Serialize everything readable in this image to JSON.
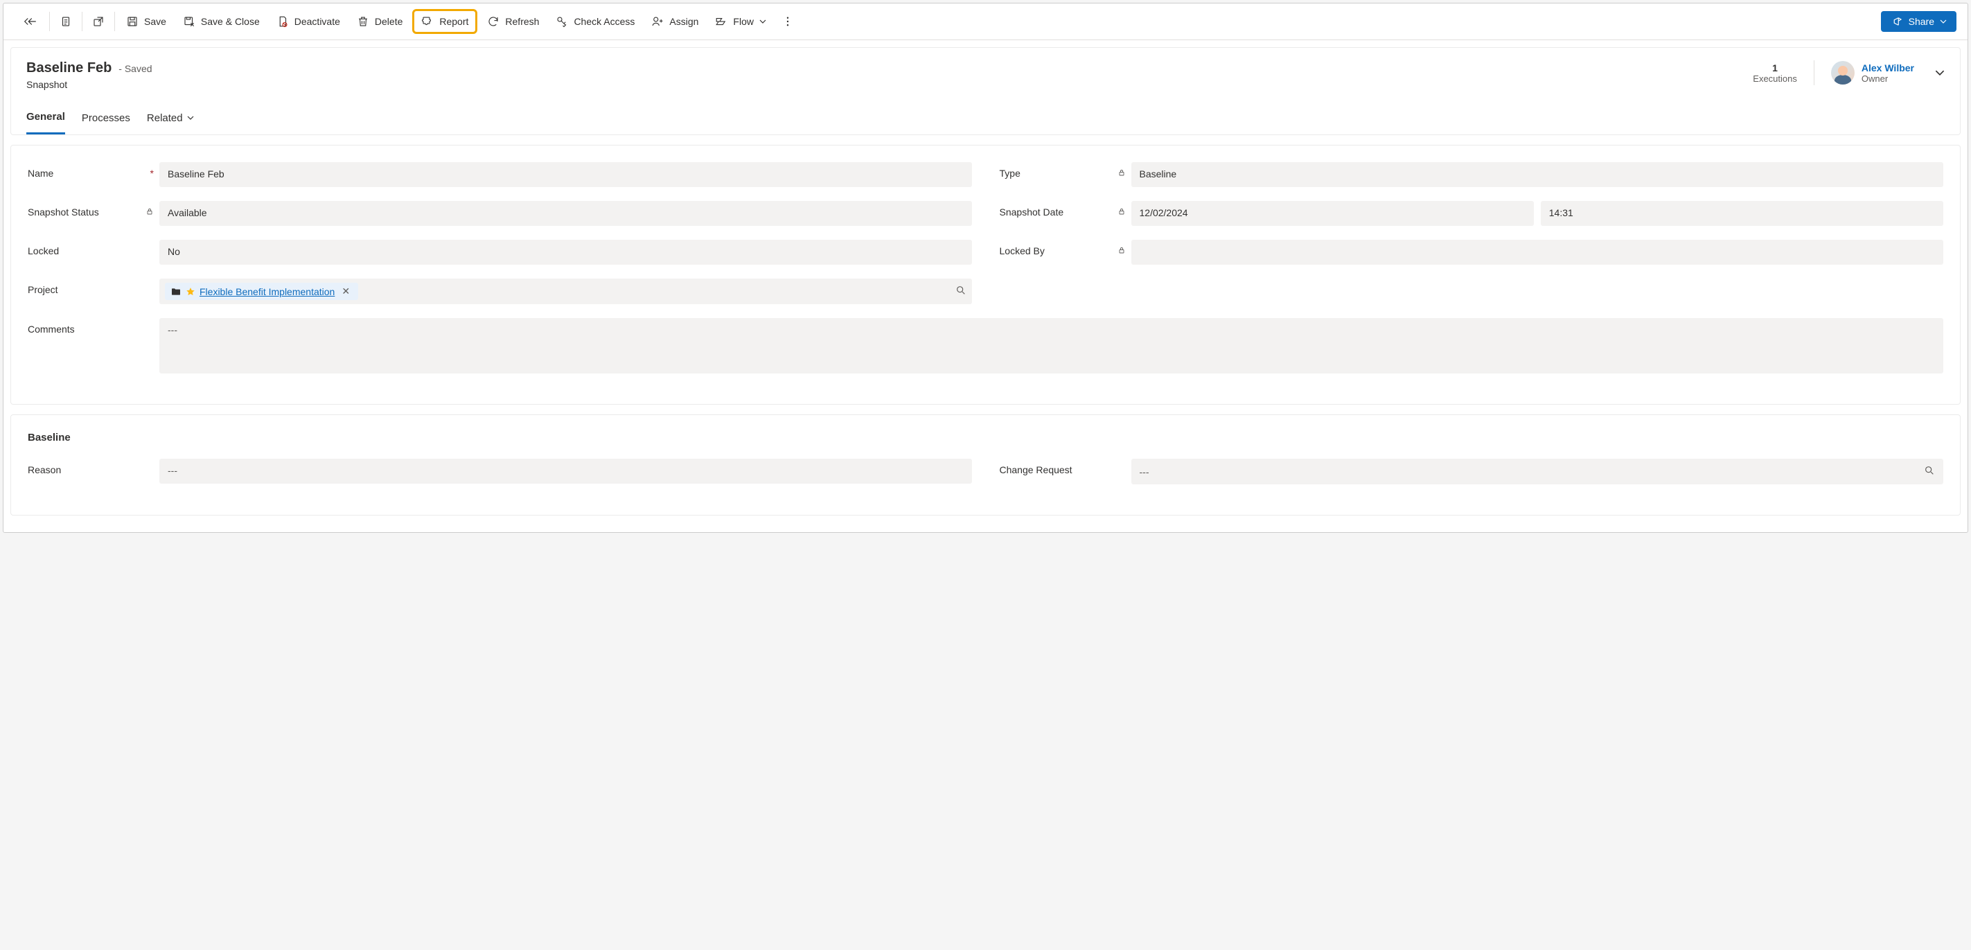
{
  "toolbar": {
    "save": "Save",
    "saveClose": "Save & Close",
    "deactivate": "Deactivate",
    "delete": "Delete",
    "report": "Report",
    "refresh": "Refresh",
    "checkAccess": "Check Access",
    "assign": "Assign",
    "flow": "Flow",
    "share": "Share"
  },
  "header": {
    "title": "Baseline Feb",
    "savedStatus": "- Saved",
    "subtitle": "Snapshot",
    "executionsValue": "1",
    "executionsLabel": "Executions",
    "ownerName": "Alex Wilber",
    "ownerLabel": "Owner"
  },
  "tabs": {
    "general": "General",
    "processes": "Processes",
    "related": "Related"
  },
  "fields": {
    "nameLabel": "Name",
    "nameValue": "Baseline Feb",
    "typeLabel": "Type",
    "typeValue": "Baseline",
    "snapshotStatusLabel": "Snapshot Status",
    "snapshotStatusValue": "Available",
    "snapshotDateLabel": "Snapshot Date",
    "snapshotDateValue": "12/02/2024",
    "snapshotTimeValue": "14:31",
    "lockedLabel": "Locked",
    "lockedValue": "No",
    "lockedByLabel": "Locked By",
    "lockedByValue": "",
    "projectLabel": "Project",
    "projectValue": "Flexible Benefit Implementation",
    "commentsLabel": "Comments",
    "commentsValue": "---"
  },
  "baseline": {
    "sectionTitle": "Baseline",
    "reasonLabel": "Reason",
    "reasonValue": "---",
    "changeRequestLabel": "Change Request",
    "changeRequestValue": "---"
  }
}
